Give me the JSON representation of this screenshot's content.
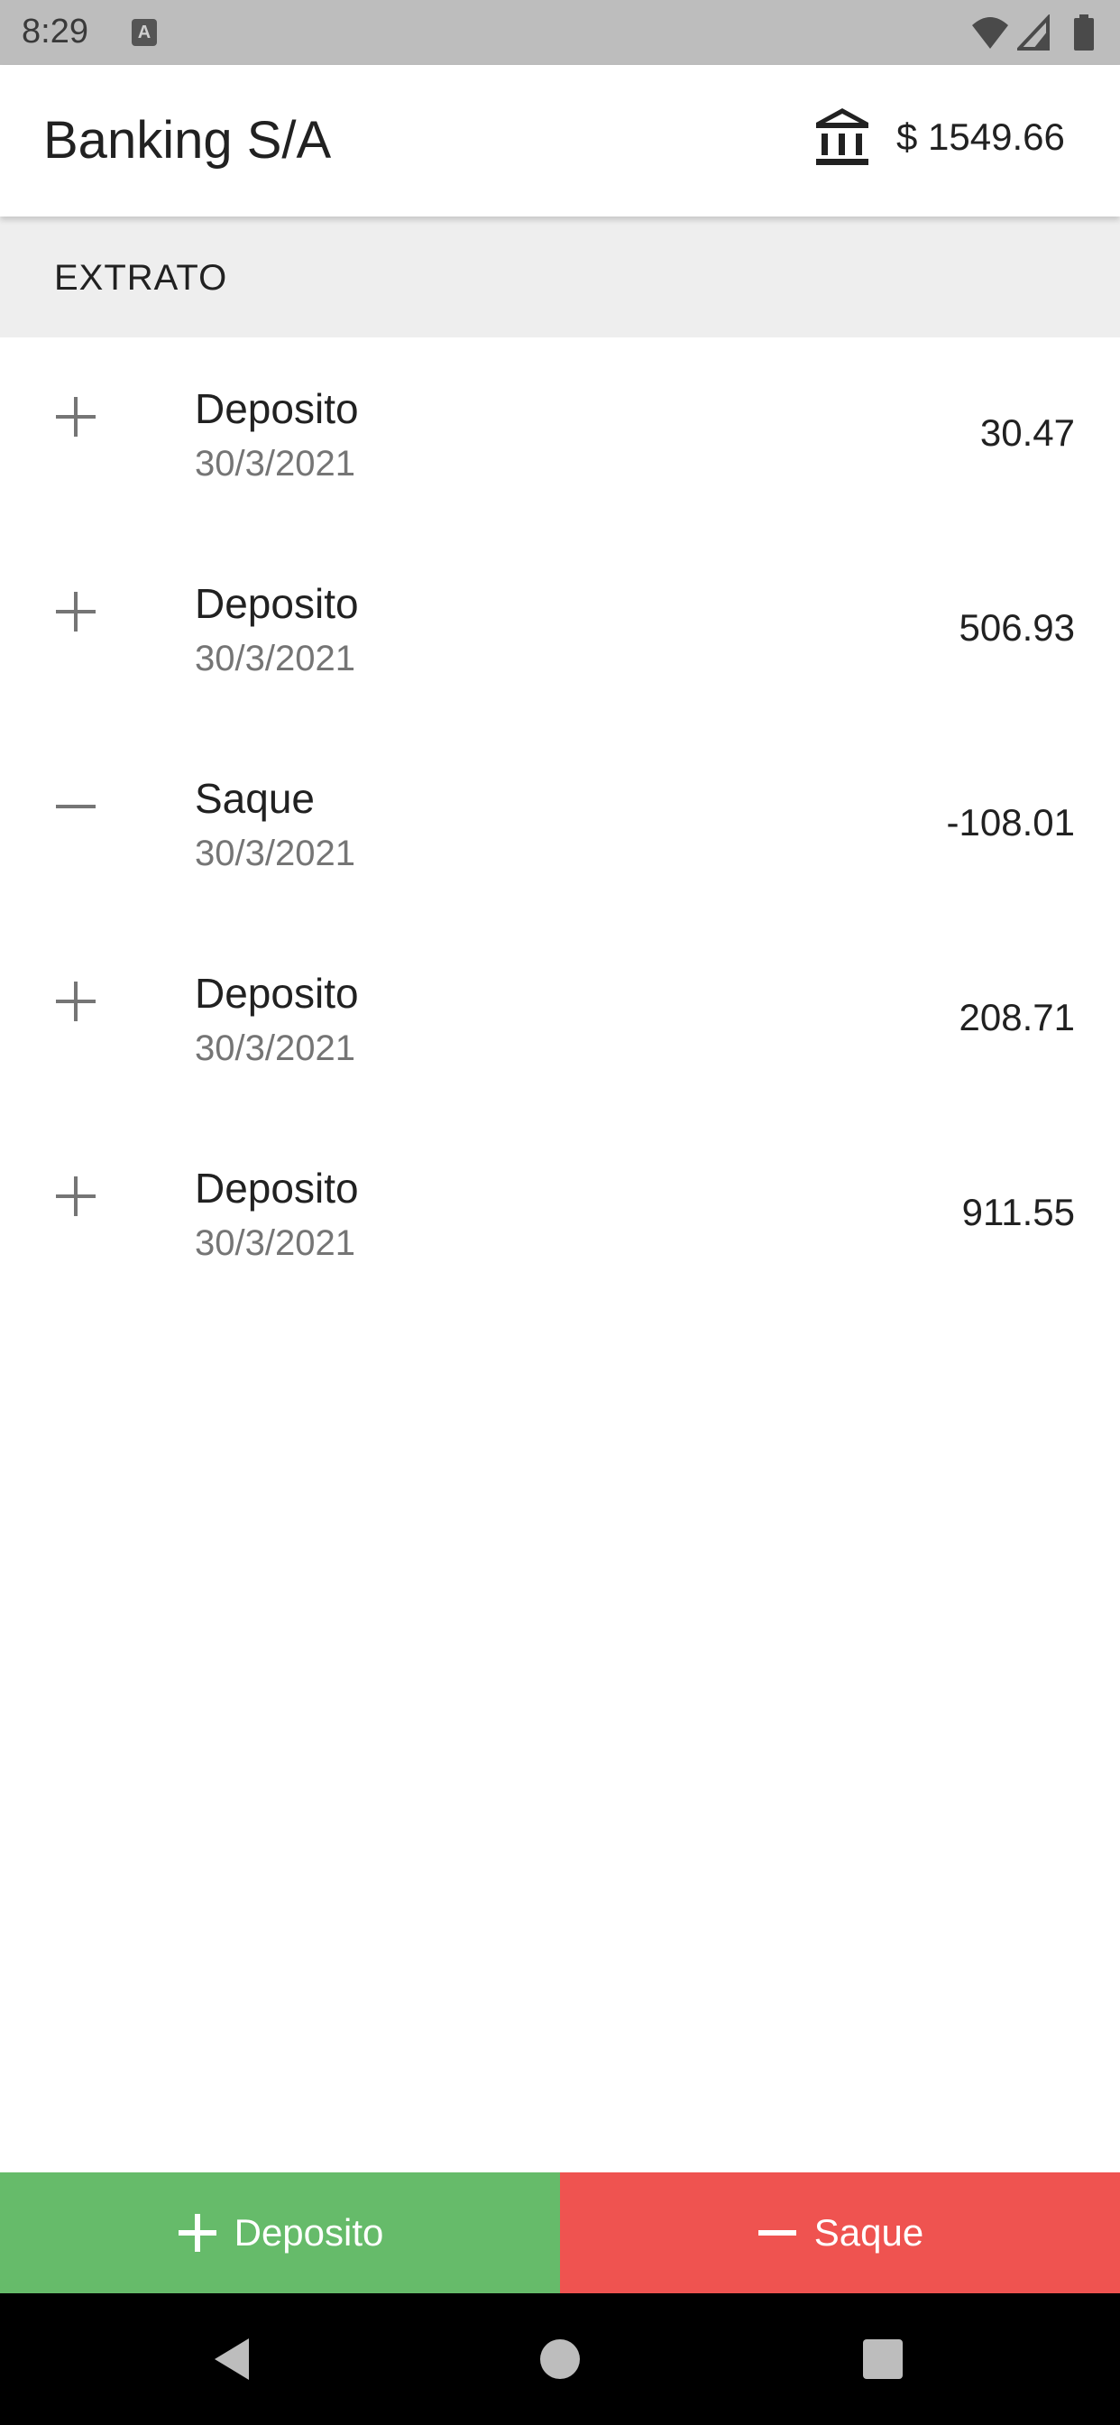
{
  "status_bar": {
    "time": "8:29",
    "notification_letter": "A"
  },
  "app_bar": {
    "title": "Banking S/A",
    "balance": "$ 1549.66",
    "bank_icon": "bank-icon"
  },
  "section": {
    "title": "EXTRATO"
  },
  "transactions": [
    {
      "type": "deposit",
      "icon": "plus-icon",
      "name": "Deposito",
      "date": "30/3/2021",
      "value": "30.47"
    },
    {
      "type": "deposit",
      "icon": "plus-icon",
      "name": "Deposito",
      "date": "30/3/2021",
      "value": "506.93"
    },
    {
      "type": "withdraw",
      "icon": "minus-icon",
      "name": "Saque",
      "date": "30/3/2021",
      "value": "-108.01"
    },
    {
      "type": "deposit",
      "icon": "plus-icon",
      "name": "Deposito",
      "date": "30/3/2021",
      "value": "208.71"
    },
    {
      "type": "deposit",
      "icon": "plus-icon",
      "name": "Deposito",
      "date": "30/3/2021",
      "value": "911.55"
    }
  ],
  "actions": {
    "deposit_label": "Deposito",
    "withdraw_label": "Saque"
  },
  "colors": {
    "deposit": "#66bb6a",
    "withdraw": "#ef5350",
    "section_bg": "#eeeeee",
    "status_bar": "#bdbdbd"
  }
}
